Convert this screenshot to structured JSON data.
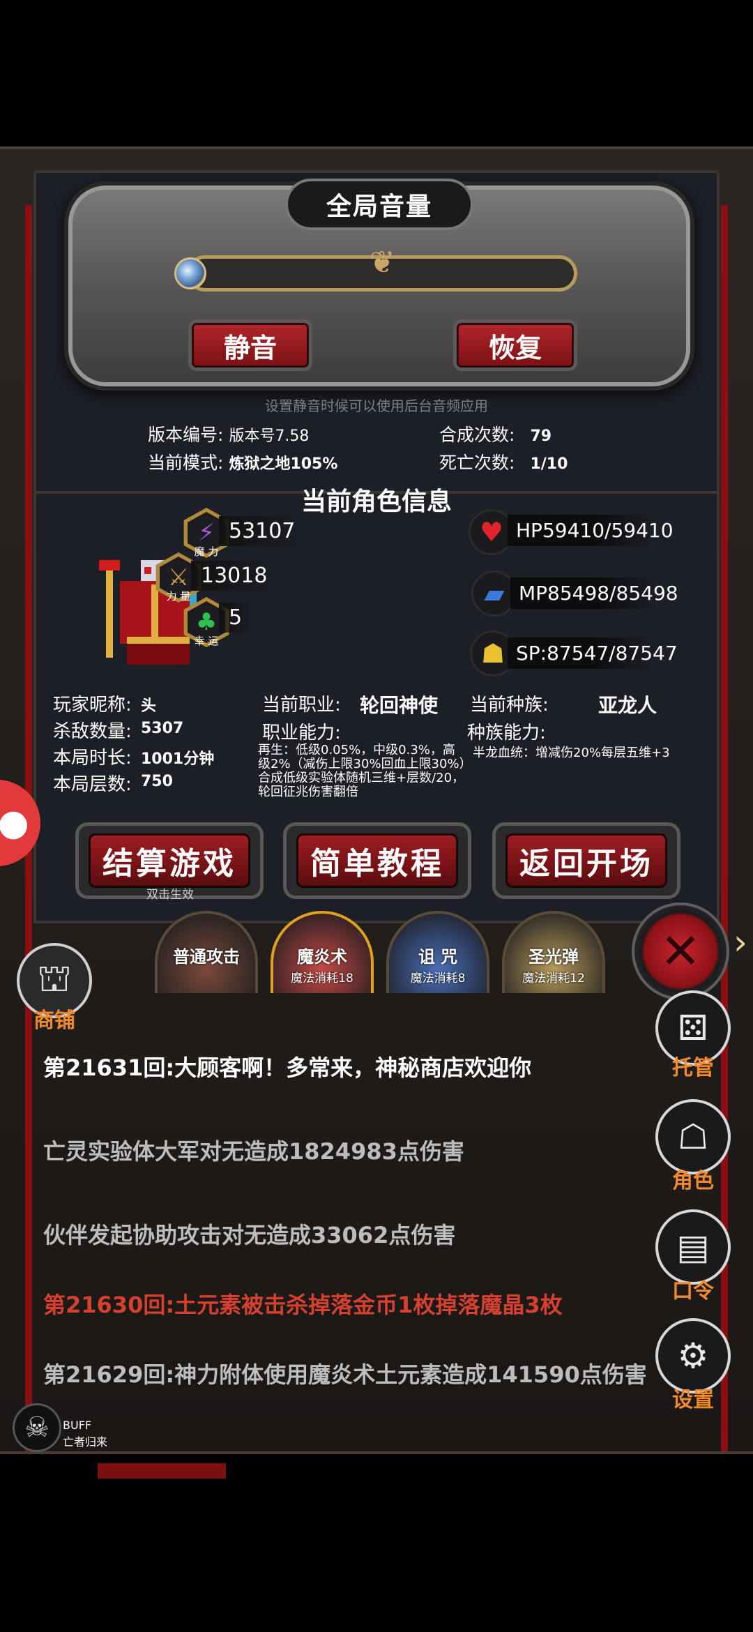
{
  "volume": {
    "title": "全局音量",
    "level": 0.0,
    "mute_label": "静音",
    "restore_label": "恢复",
    "note": "设置静音时候可以使用后台音频应用"
  },
  "game_info": {
    "version_label": "版本编号:",
    "version_value": "版本号7.58",
    "mode_label": "当前模式:",
    "mode_value": "炼狱之地105%",
    "synth_label": "合成次数:",
    "synth_value": "79",
    "death_label": "死亡次数:",
    "death_value": "1/10"
  },
  "character": {
    "section_title": "当前角色信息",
    "stats": [
      {
        "icon": "lightning-icon",
        "caption": "魔 力",
        "value": "53107",
        "color": "#8b3fd0"
      },
      {
        "icon": "sword-icon",
        "caption": "力 量",
        "value": "13018",
        "color": "#c0882e"
      },
      {
        "icon": "clover-icon",
        "caption": "幸 运",
        "value": "5",
        "color": "#2fb24a"
      }
    ],
    "resources": {
      "hp": "HP59410/59410",
      "mp": "MP85498/85498",
      "sp": "SP:87547/87547"
    },
    "nickname_label": "玩家昵称:",
    "nickname_value": "头",
    "kills_label": "杀敌数量:",
    "kills_value": "5307",
    "duration_label": "本局时长:",
    "duration_value": "1001分钟",
    "floors_label": "本局层数:",
    "floors_value": "750",
    "job_label": "当前职业:",
    "job_value": "轮回神使",
    "job_ability_label": "职业能力:",
    "job_ability_desc": "再生：低级0.05%，中级0.3%，高级2%（减伤上限30%回血上限30%）合成低级实验体随机三维+层数/20，轮回征兆伤害翻倍",
    "race_label": "当前种族:",
    "race_value": "亚龙人",
    "race_ability_label": "种族能力:",
    "race_ability_desc": "半龙血统：增减伤20%每层五维+3"
  },
  "actions": {
    "settle_label": "结算游戏",
    "settle_hint": "双击生效",
    "tutorial_label": "简单教程",
    "return_label": "返回开场"
  },
  "skills": [
    {
      "name": "普通攻击",
      "cost": "",
      "color": "#7a4a3a"
    },
    {
      "name": "魔炎术",
      "cost": "魔法消耗18",
      "color": "#c44a44"
    },
    {
      "name": "诅 咒",
      "cost": "魔法消耗8",
      "color": "#4a6fb8"
    },
    {
      "name": "圣光弹",
      "cost": "魔法消耗12",
      "color": "#b89a5a"
    }
  ],
  "log": [
    {
      "text": "第21631回:大顾客啊！多常来，神秘商店欢迎你",
      "color": "#ffffff"
    },
    {
      "text": "亡灵实验体大军对无造成1824983点伤害",
      "color": "#bdbdbd"
    },
    {
      "text": "伙伴发起协助攻击对无造成33062点伤害",
      "color": "#bdbdbd"
    },
    {
      "text": "第21630回:土元素被击杀掉落金币1枚掉落魔晶3枚",
      "color": "#d6412f"
    },
    {
      "text": "第21629回:神力附体使用魔炎术土元素造成141590点伤害",
      "color": "#bdbdbd"
    }
  ],
  "side_menu": {
    "shop": "商铺",
    "auto": "托管",
    "role": "角色",
    "code": "口令",
    "settings": "设置"
  },
  "buff": {
    "title": "BUFF",
    "subtitle": "亡者归来"
  }
}
